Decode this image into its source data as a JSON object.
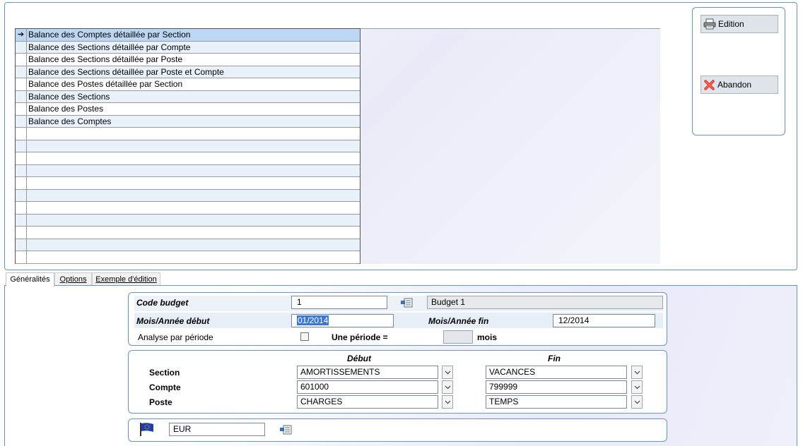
{
  "reports": {
    "items": [
      "Balance des Comptes détaillée par Section",
      "Balance des Sections détaillée par Compte",
      "Balance des Sections détaillée par Poste",
      "Balance des Sections détaillée par Poste et Compte",
      "Balance des Postes détaillée par Section",
      "Balance des Sections",
      "Balance des Postes",
      "Balance des Comptes"
    ],
    "selected_index": 0,
    "selected_marker": "➔"
  },
  "buttons": {
    "edition": "Edition",
    "abandon": "Abandon"
  },
  "tabs": [
    "Généralités",
    "Options",
    "Exemple d'édition"
  ],
  "general": {
    "code_budget_label": "Code budget",
    "code_budget_value": "1",
    "budget_name": "Budget 1",
    "start_label": "Mois/Année début",
    "start_value": "01/2014",
    "end_label": "Mois/Année fin",
    "end_value": "12/2014",
    "analysis_label": "Analyse par période",
    "period_label": "Une période =",
    "period_value": "",
    "months_label": "mois"
  },
  "ranges": {
    "start_header": "Début",
    "end_header": "Fin",
    "section_label": "Section",
    "section_start": "AMORTISSEMENTS",
    "section_end": "VACANCES",
    "compte_label": "Compte",
    "compte_start": "601000",
    "compte_end": "799999",
    "poste_label": "Poste",
    "poste_start": "CHARGES",
    "poste_end": "TEMPS"
  },
  "currency": {
    "code": "EUR",
    "icon": "eu-flag-icon"
  },
  "colors": {
    "accent": "#6d94b8",
    "selected_row": "#bcd7f4",
    "alt_row": "#e9f1fa"
  }
}
